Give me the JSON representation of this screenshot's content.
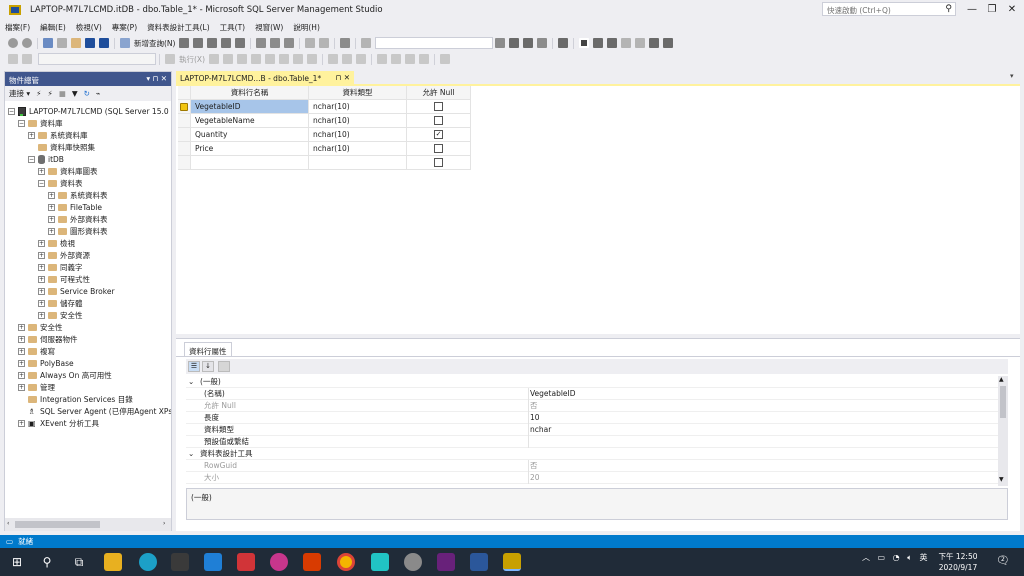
{
  "window": {
    "title": "LAPTOP-M7L7LCMD.itDB - dbo.Table_1* - Microsoft SQL Server Management Studio",
    "quick_launch_placeholder": "快速啟動 (Ctrl+Q)",
    "minimize": "—",
    "restore": "❐",
    "close": "✕"
  },
  "menu": [
    "檔案(F)",
    "編輯(E)",
    "檢視(V)",
    "專案(P)",
    "資料表設計工具(L)",
    "工具(T)",
    "視窗(W)",
    "說明(H)"
  ],
  "toolbar": {
    "new_query": "新增查詢(N)",
    "execute": "執行(X)"
  },
  "object_explorer": {
    "title": "物件總管",
    "title_controls": "▾ ⊓ ✕",
    "connect_label": "連接 ▾",
    "server": "LAPTOP-M7L7LCMD (SQL Server 15.0",
    "nodes": {
      "databases": "資料庫",
      "system_databases": "系統資料庫",
      "db_snapshots": "資料庫快照集",
      "itdb": "itDB",
      "db_diagrams": "資料庫圖表",
      "tables": "資料表",
      "system_tables": "系統資料表",
      "filetable": "FileTable",
      "external_tables": "外部資料表",
      "graph_tables": "圖形資料表",
      "views": "檢視",
      "external_resources": "外部資源",
      "synonyms": "同義字",
      "programmability": "可程式性",
      "service_broker": "Service Broker",
      "storage": "儲存體",
      "security_db": "安全性",
      "security": "安全性",
      "server_objects": "伺服器物件",
      "replication": "複寫",
      "polybase": "PolyBase",
      "always_on": "Always On 高可用性",
      "management": "管理",
      "integration_services": "Integration Services 目錄",
      "sql_agent": "SQL Server Agent (已停用Agent XPs",
      "xevent": "XEvent 分析工具"
    }
  },
  "document_tab": {
    "label": "LAPTOP-M7L7LCMD...B - dbo.Table_1*",
    "controls": "⊓ ✕"
  },
  "table_designer": {
    "headers": [
      "資料行名稱",
      "資料類型",
      "允許 Null"
    ],
    "rows": [
      {
        "name": "VegetableID",
        "type": "nchar(10)",
        "allow_null": false,
        "primary_key": true,
        "selected": true
      },
      {
        "name": "VegetableName",
        "type": "nchar(10)",
        "allow_null": false,
        "primary_key": false,
        "selected": false
      },
      {
        "name": "Quantity",
        "type": "nchar(10)",
        "allow_null": true,
        "primary_key": false,
        "selected": false
      },
      {
        "name": "Price",
        "type": "nchar(10)",
        "allow_null": false,
        "primary_key": false,
        "selected": false
      },
      {
        "name": "",
        "type": "",
        "allow_null": false,
        "primary_key": false,
        "selected": false
      }
    ]
  },
  "properties": {
    "tab_label": "資料行屬性",
    "rows": [
      {
        "kind": "category",
        "label": "(一般)",
        "value": ""
      },
      {
        "kind": "prop",
        "label": "(名稱)",
        "value": "VegetableID",
        "grey": false
      },
      {
        "kind": "prop",
        "label": "允許 Null",
        "value": "否",
        "grey": true
      },
      {
        "kind": "prop",
        "label": "長度",
        "value": "10",
        "grey": false
      },
      {
        "kind": "prop",
        "label": "資料類型",
        "value": "nchar",
        "grey": false
      },
      {
        "kind": "prop",
        "label": "預設值或繫結",
        "value": "",
        "grey": false
      },
      {
        "kind": "category",
        "label": "資料表設計工具",
        "value": ""
      },
      {
        "kind": "prop",
        "label": "RowGuid",
        "value": "否",
        "grey": true
      },
      {
        "kind": "prop",
        "label": "大小",
        "value": "20",
        "grey": true
      }
    ],
    "description": "(一般)"
  },
  "status": {
    "text": "就緒"
  },
  "taskbar": {
    "time": "下午 12:50",
    "date": "2020/9/17",
    "ime": "英",
    "notifications": "2"
  }
}
